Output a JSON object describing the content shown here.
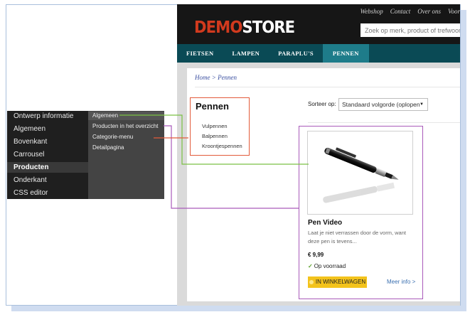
{
  "store": {
    "top_links": [
      "Webshop",
      "Contact",
      "Over ons",
      "Voor"
    ],
    "logo_part1": "DEMO",
    "logo_part2": "STORE",
    "search_placeholder": "Zoek op merk, product of trefwoord...",
    "nav": [
      "FIETSEN",
      "LAMPEN",
      "PARAPLU'S",
      "PENNEN"
    ],
    "active_nav": "PENNEN",
    "breadcrumb": "Home > Pennen",
    "category": {
      "title": "Pennen",
      "links": [
        "Vulpennen",
        "Balpennen",
        "Kroontjespennen"
      ]
    },
    "sort": {
      "label": "Sorteer op:",
      "value": "Standaard volgorde (oplopen"
    },
    "product": {
      "name": "Pen Video",
      "description_line1": "Laat je niet verrassen door de vorm, want",
      "description_line2": "deze pen is tevens...",
      "price": "€ 9,99",
      "stock": "Op voorraad",
      "cart_label": "IN WINKELWAGEN",
      "more_info": "Meer info >"
    }
  },
  "editor_menu": {
    "items": [
      "Ontwerp informatie",
      "Algemeen",
      "Bovenkant",
      "Carrousel",
      "Producten",
      "Onderkant",
      "CSS editor"
    ],
    "active_item": "Producten",
    "sub_items": [
      "Algemeen",
      "Producten in het overzicht",
      "Categorie-menu",
      "Detailpagina"
    ]
  },
  "colors": {
    "logo_accent": "#d23a1e",
    "nav_bg": "#0a4a55",
    "nav_active": "#1e7c8a",
    "category_outline": "#e25a3a",
    "product_outline": "#a95aba",
    "connector_green": "#7bc143",
    "cart_button": "#f3c31c"
  }
}
